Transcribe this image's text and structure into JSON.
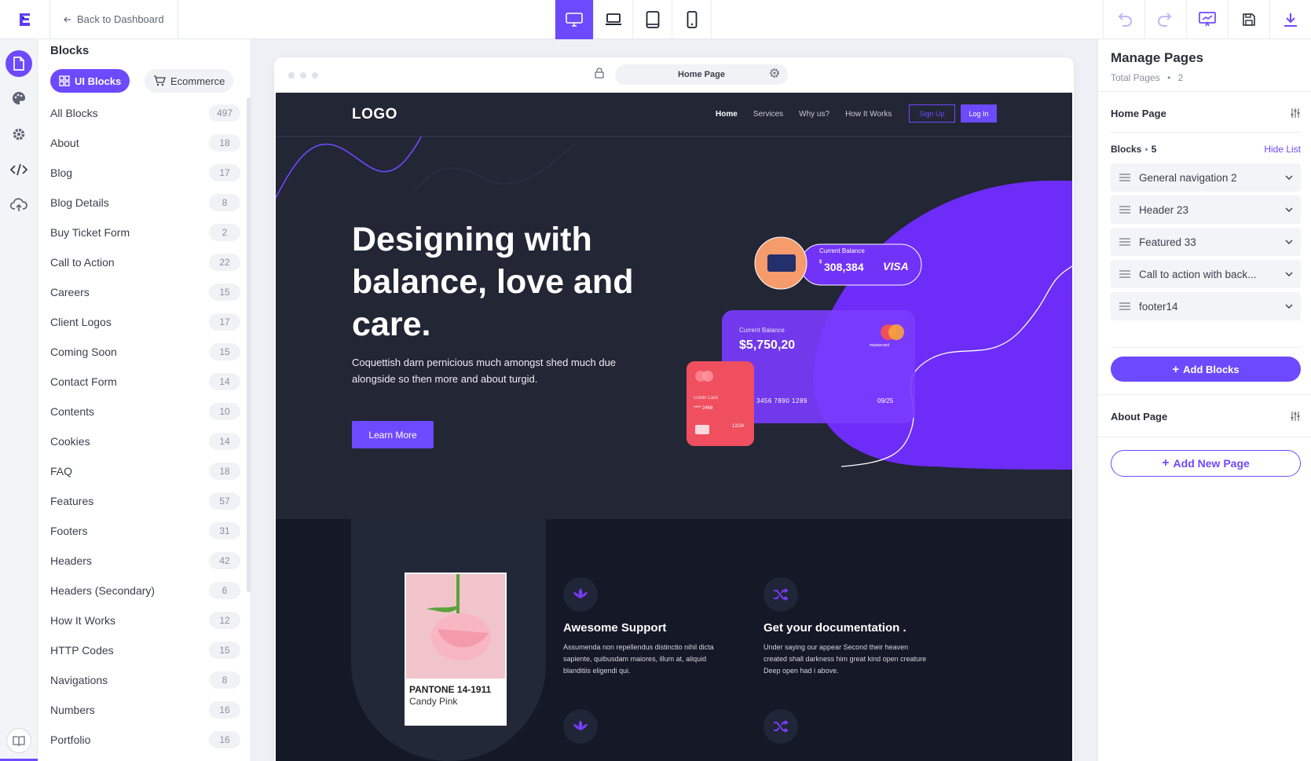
{
  "topbar": {
    "back_label": "Back to Dashboard",
    "devices": [
      "desktop-icon",
      "laptop-icon",
      "tablet-icon",
      "phone-icon"
    ],
    "actions": [
      "undo-icon",
      "redo-icon",
      "preview-icon",
      "save-icon",
      "download-icon"
    ]
  },
  "sidebar_rail": {
    "items": [
      "pages-icon",
      "palette-icon",
      "settings-icon",
      "code-icon",
      "cloud-upload-icon"
    ],
    "bottom": "book-icon"
  },
  "blocks_panel": {
    "title": "Blocks",
    "tabs": [
      {
        "label": "UI Blocks",
        "active": true
      },
      {
        "label": "Ecommerce",
        "active": false
      }
    ],
    "categories": [
      {
        "label": "All Blocks",
        "count": "497"
      },
      {
        "label": "About",
        "count": "18"
      },
      {
        "label": "Blog",
        "count": "17"
      },
      {
        "label": "Blog Details",
        "count": "8"
      },
      {
        "label": "Buy Ticket Form",
        "count": "2"
      },
      {
        "label": "Call to Action",
        "count": "22"
      },
      {
        "label": "Careers",
        "count": "15"
      },
      {
        "label": "Client Logos",
        "count": "17"
      },
      {
        "label": "Coming Soon",
        "count": "15"
      },
      {
        "label": "Contact Form",
        "count": "14"
      },
      {
        "label": "Contents",
        "count": "10"
      },
      {
        "label": "Cookies",
        "count": "14"
      },
      {
        "label": "FAQ",
        "count": "18"
      },
      {
        "label": "Features",
        "count": "57"
      },
      {
        "label": "Footers",
        "count": "31"
      },
      {
        "label": "Headers",
        "count": "42"
      },
      {
        "label": "Headers (Secondary)",
        "count": "6"
      },
      {
        "label": "How It Works",
        "count": "12"
      },
      {
        "label": "HTTP Codes",
        "count": "15"
      },
      {
        "label": "Navigations",
        "count": "8"
      },
      {
        "label": "Numbers",
        "count": "16"
      },
      {
        "label": "Portfolio",
        "count": "16"
      }
    ]
  },
  "canvas": {
    "url_label": "Home Page",
    "site": {
      "logo": "LOGO",
      "nav": [
        "Home",
        "Services",
        "Why us?",
        "How It Works"
      ],
      "signup": "Sign Up",
      "login": "Log In",
      "headline": "Designing with balance, love and care.",
      "subtext": "Coquettish darn pernicious much amongst shed much due alongside so then more and about turgid.",
      "cta": "Learn More",
      "card_small": {
        "label": "Current Balance",
        "currency": "$",
        "amount": "308,384",
        "brand": "VISA"
      },
      "card_big": {
        "label": "Current Balance",
        "amount": "$5,750,20",
        "number": "3456 7890 1289",
        "expiry": "09/25",
        "brand": "mastercard"
      },
      "card_red": {
        "label": "Credit Card",
        "masked": "**** 2468",
        "expiry": "12/24"
      },
      "pantone": {
        "code": "PANTONE 14-1911",
        "name": "Candy Pink"
      },
      "features": [
        {
          "title": "Awesome Support",
          "text": "Assumenda non repellendus distinctio nihil dicta sapiente, quibusdam maiores, illum at, aliquid blanditiis eligendi qui."
        },
        {
          "title": "Get your documentation .",
          "text": "Under saying our appear Second their heaven created shall darkness him great kind open creature Deep open had i above."
        }
      ]
    }
  },
  "pages_panel": {
    "title": "Manage Pages",
    "total_label": "Total Pages",
    "total": "2",
    "pages": [
      {
        "name": "Home Page",
        "blocks_label": "Blocks",
        "blocks_count": "5",
        "hide_label": "Hide List",
        "blocks": [
          "General navigation 2",
          "Header 23",
          "Featured 33",
          "Call to action with back...",
          "footer14"
        ],
        "add_blocks": "Add Blocks"
      },
      {
        "name": "About Page"
      }
    ],
    "add_page": "Add New Page"
  },
  "colors": {
    "accent": "#6d4aff",
    "site_bg": "#222635",
    "footer_bg": "#141827",
    "card_red": "#ef4f5f"
  }
}
